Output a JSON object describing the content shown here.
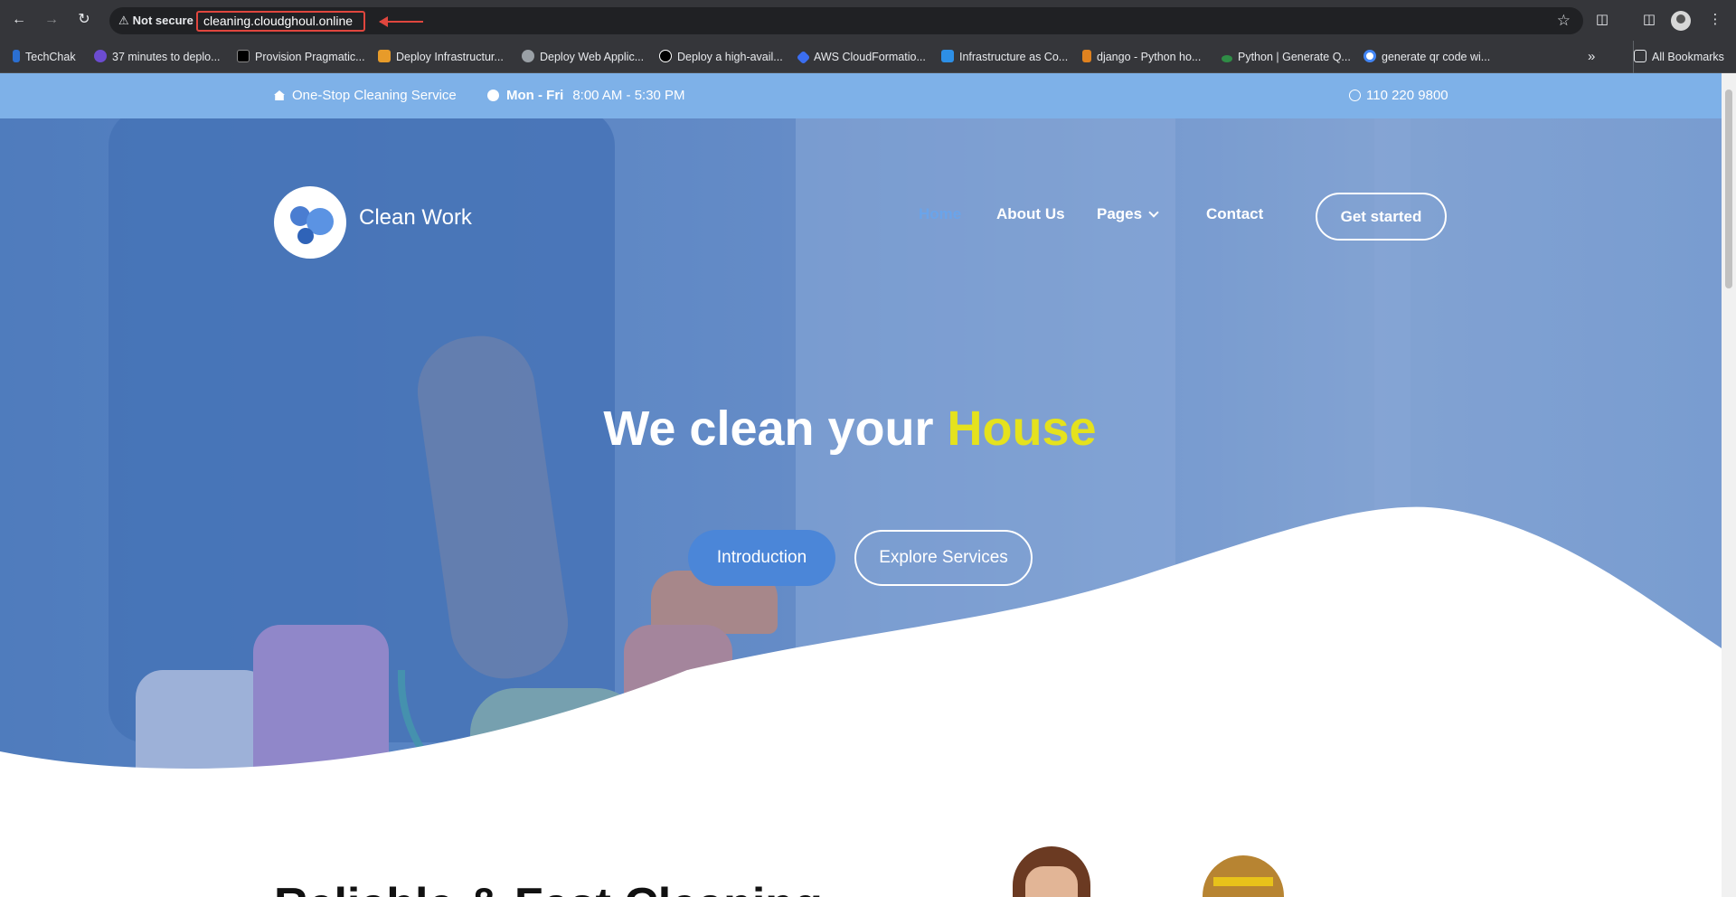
{
  "browser": {
    "security_label": "Not secure",
    "url": "cleaning.cloudghoul.online",
    "bookmarks": [
      {
        "label": "TechChak",
        "color": "#2b6fd1"
      },
      {
        "label": "37 minutes to deplo...",
        "color": "#6c4cd1"
      },
      {
        "label": "Provision Pragmatic...",
        "color": "#000000"
      },
      {
        "label": "Deploy Infrastructur...",
        "color": "#e79b2a"
      },
      {
        "label": "Deploy Web Applic...",
        "color": "#202124"
      },
      {
        "label": "Deploy a high-avail...",
        "color": "#000000"
      },
      {
        "label": "AWS CloudFormatio...",
        "color": "#3b6ef0"
      },
      {
        "label": "Infrastructure as Co...",
        "color": "#2d8fe6"
      },
      {
        "label": "django - Python ho...",
        "color": "#e0821f"
      },
      {
        "label": "Python | Generate Q...",
        "color": "#2f8d46"
      },
      {
        "label": "generate qr code wi...",
        "color": "#ffffff"
      }
    ],
    "all_bookmarks_label": "All Bookmarks",
    "accent_color": "#e0463e"
  },
  "topbar": {
    "tagline": "One-Stop Cleaning Service",
    "hours_days": "Mon - Fri",
    "hours_time": "8:00 AM - 5:30 PM",
    "phone": "110 220 9800"
  },
  "header": {
    "brand": "Clean Work",
    "nav": {
      "home": "Home",
      "about": "About Us",
      "pages": "Pages",
      "contact": "Contact"
    },
    "cta": "Get started"
  },
  "hero": {
    "title_prefix": "We clean your ",
    "title_highlight": "House",
    "primary_button": "Introduction",
    "secondary_button": "Explore Services"
  },
  "section": {
    "title_partial": "Reliable & Fast Cleaning"
  },
  "colors": {
    "topbar_bg": "#7eb1e8",
    "primary": "#4b86d8",
    "highlight": "#e5e21d"
  }
}
